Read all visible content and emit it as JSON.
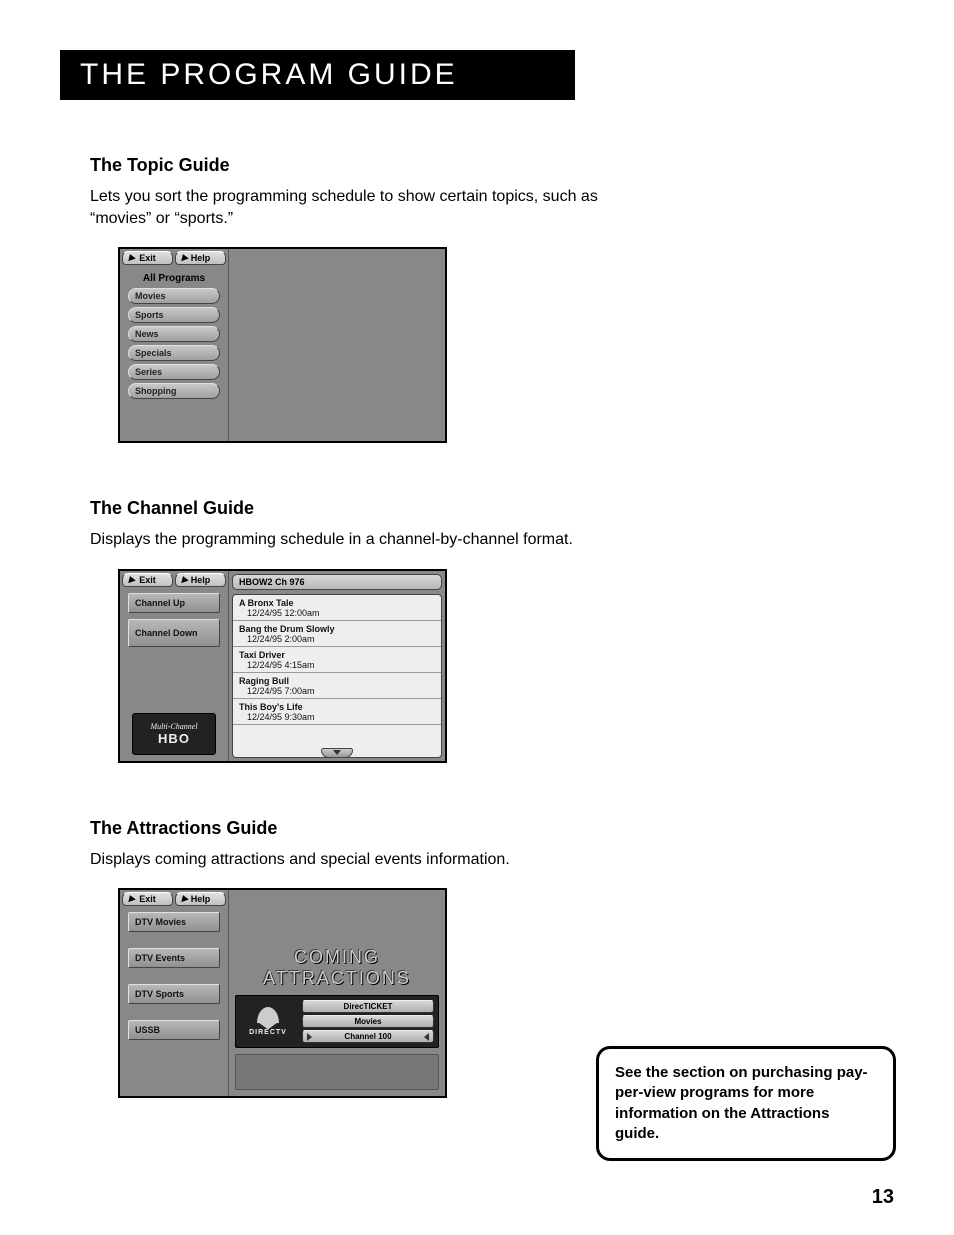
{
  "page_title": "The Program Guide",
  "page_number": "13",
  "sections": {
    "topic": {
      "heading": "The Topic Guide",
      "body": "Lets you sort the programming schedule to show certain topics, such as “movies” or “sports.”"
    },
    "channel": {
      "heading": "The Channel Guide",
      "body": "Displays the programming schedule in a channel-by-channel format."
    },
    "attractions": {
      "heading": "The Attractions Guide",
      "body": "Displays coming attractions and special events information."
    }
  },
  "topic_screen": {
    "tabs": {
      "exit": "Exit",
      "help": "Help"
    },
    "header": "All Programs",
    "items": [
      "Movies",
      "Sports",
      "News",
      "Specials",
      "Series",
      "Shopping"
    ]
  },
  "channel_screen": {
    "tabs": {
      "exit": "Exit",
      "help": "Help"
    },
    "buttons": {
      "up": "Channel Up",
      "down": "Channel Down"
    },
    "logo_top": "Multi-Channel",
    "logo_main": "HBO",
    "channel_header": "HBOW2  Ch  976",
    "programs": [
      {
        "title": "A Bronx Tale",
        "time": "12/24/95   12:00am"
      },
      {
        "title": "Bang the Drum Slowly",
        "time": "12/24/95   2:00am"
      },
      {
        "title": "Taxi Driver",
        "time": "12/24/95   4:15am"
      },
      {
        "title": "Raging Bull",
        "time": "12/24/95   7:00am"
      },
      {
        "title": "This Boy's Life",
        "time": "12/24/95   9:30am"
      }
    ]
  },
  "attractions_screen": {
    "tabs": {
      "exit": "Exit",
      "help": "Help"
    },
    "side_buttons": [
      "DTV Movies",
      "DTV Events",
      "DTV Sports",
      "USSB"
    ],
    "banner": "COMING ATTRACTIONS",
    "logo_text": "DIRECTV",
    "menu": {
      "a": "DirecTICKET",
      "b": "Movies",
      "c": "Channel 100"
    }
  },
  "note": "See the section on purchasing pay-per-view programs for more information on the Attractions guide."
}
